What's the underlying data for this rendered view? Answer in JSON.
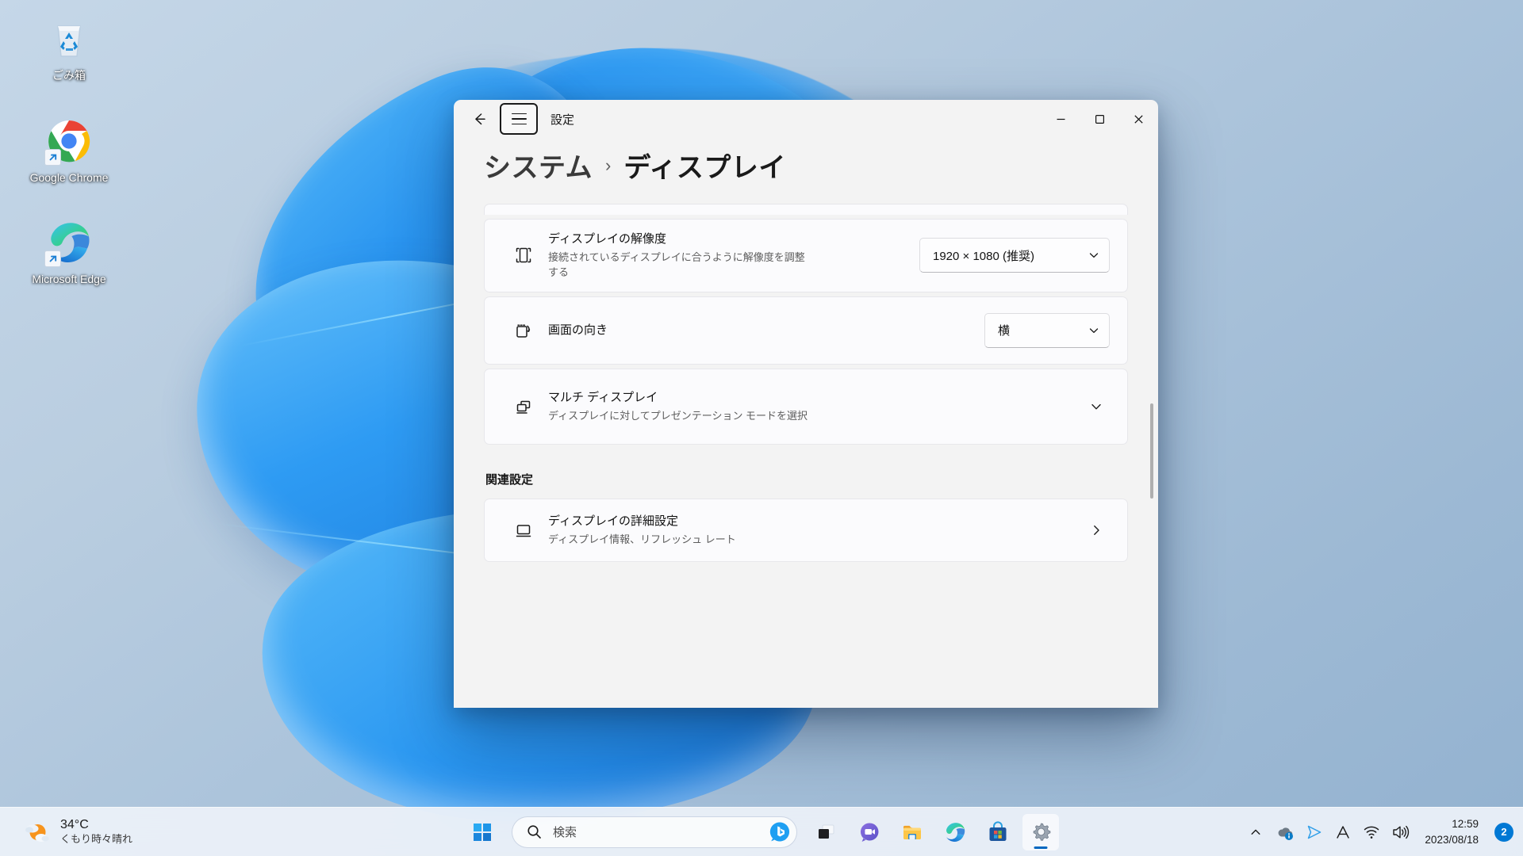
{
  "desktop": {
    "icons": [
      {
        "name": "recycle-bin",
        "label": "ごみ箱",
        "icon": "recycle-bin-icon",
        "shortcut": false
      },
      {
        "name": "google-chrome",
        "label": "Google Chrome",
        "icon": "chrome-icon",
        "shortcut": true
      },
      {
        "name": "microsoft-edge",
        "label": "Microsoft Edge",
        "icon": "edge-icon",
        "shortcut": true
      }
    ]
  },
  "window": {
    "title": "設定",
    "back_icon": "back-arrow-icon",
    "menu_icon": "hamburger-menu-icon",
    "controls": {
      "minimize": "minimize-icon",
      "maximize": "maximize-icon",
      "close": "close-icon"
    },
    "breadcrumb": {
      "parent": "システム",
      "separator": "›",
      "current": "ディスプレイ"
    }
  },
  "settings": {
    "cards": [
      {
        "name": "display-resolution",
        "icon": "resolution-icon",
        "title": "ディスプレイの解像度",
        "subtitle": "接続されているディスプレイに合うように解像度を調整する",
        "control": "dropdown",
        "value": "1920 × 1080 (推奨)"
      },
      {
        "name": "display-orientation",
        "icon": "orientation-icon",
        "title": "画面の向き",
        "subtitle": "",
        "control": "dropdown",
        "value": "横"
      },
      {
        "name": "multiple-displays",
        "icon": "multi-display-icon",
        "title": "マルチ ディスプレイ",
        "subtitle": "ディスプレイに対してプレゼンテーション モードを選択",
        "control": "expander",
        "value": ""
      }
    ],
    "related_section": {
      "heading": "関連設定",
      "items": [
        {
          "name": "advanced-display",
          "icon": "monitor-icon",
          "title": "ディスプレイの詳細設定",
          "subtitle": "ディスプレイ情報、リフレッシュ レート",
          "control": "navigate"
        }
      ]
    }
  },
  "taskbar": {
    "weather": {
      "icon": "sun-behind-cloud-icon",
      "temperature": "34°C",
      "condition": "くもり時々晴れ"
    },
    "start": {
      "name": "start-button",
      "icon": "windows-logo-icon"
    },
    "search": {
      "icon": "search-icon",
      "placeholder": "検索",
      "bing_icon": "bing-chat-icon"
    },
    "apps": [
      {
        "name": "task-view",
        "icon": "task-view-icon",
        "active": false
      },
      {
        "name": "chat",
        "icon": "chat-icon",
        "active": false
      },
      {
        "name": "file-explorer",
        "icon": "file-explorer-icon",
        "active": false
      },
      {
        "name": "microsoft-edge",
        "icon": "edge-icon",
        "active": false
      },
      {
        "name": "microsoft-store",
        "icon": "store-icon",
        "active": false
      },
      {
        "name": "settings",
        "icon": "settings-gear-icon",
        "active": true
      }
    ],
    "tray": [
      {
        "name": "show-hidden-icons",
        "icon": "chevron-up-icon"
      },
      {
        "name": "onedrive",
        "icon": "onedrive-icon"
      },
      {
        "name": "telegram",
        "icon": "send-icon"
      },
      {
        "name": "ime-mode",
        "icon": "ime-a-icon",
        "label": "A"
      },
      {
        "name": "network",
        "icon": "wifi-icon"
      },
      {
        "name": "volume",
        "icon": "speaker-icon"
      }
    ],
    "clock": {
      "time": "12:59",
      "date": "2023/08/18"
    },
    "notifications": {
      "count": "2"
    }
  },
  "colors": {
    "accent": "#0078d4",
    "window_bg": "#f0f3f9",
    "card_bg": "#fbfbfd",
    "desktop_base": "#a9c2da"
  }
}
